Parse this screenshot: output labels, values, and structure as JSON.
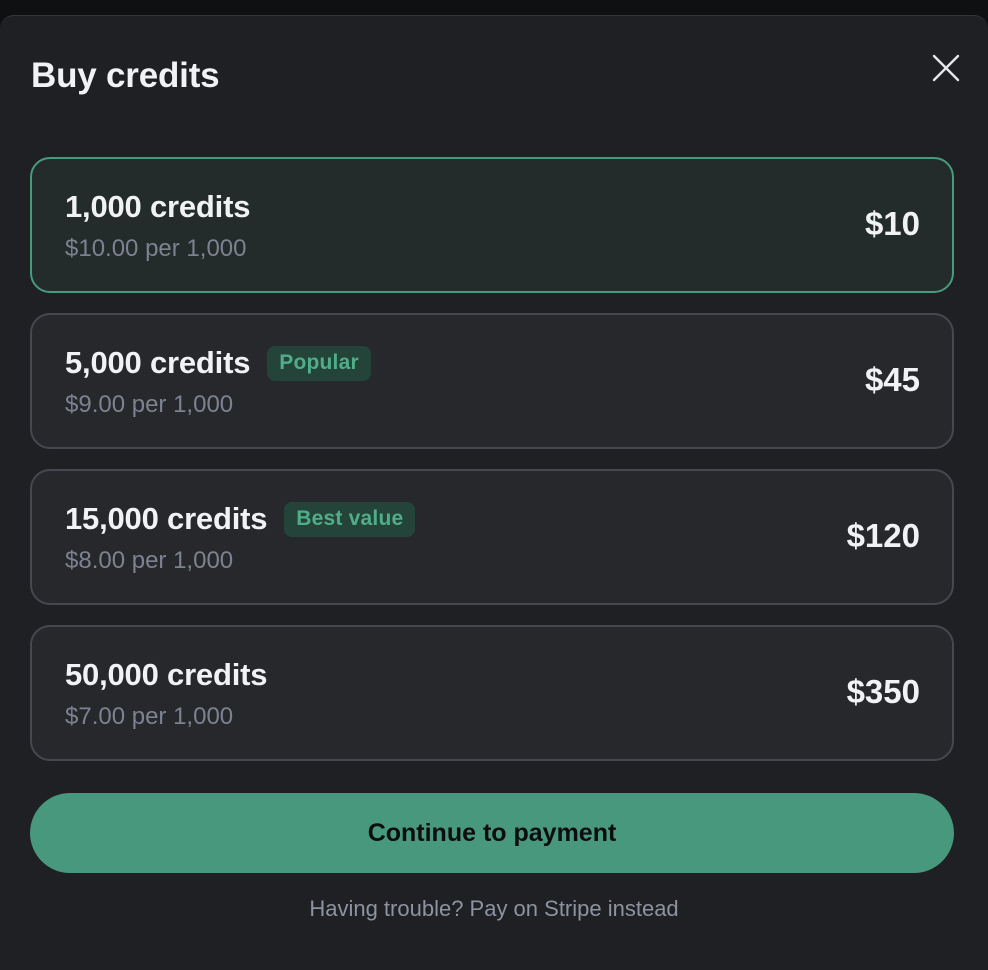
{
  "dialog": {
    "title": "Buy credits"
  },
  "options": [
    {
      "name": "1,000 credits",
      "per": "$10.00 per 1,000",
      "price": "$10",
      "badge": "",
      "selected": true
    },
    {
      "name": "5,000 credits",
      "per": "$9.00 per 1,000",
      "price": "$45",
      "badge": "Popular",
      "selected": false
    },
    {
      "name": "15,000 credits",
      "per": "$8.00 per 1,000",
      "price": "$120",
      "badge": "Best value",
      "selected": false
    },
    {
      "name": "50,000 credits",
      "per": "$7.00 per 1,000",
      "price": "$350",
      "badge": "",
      "selected": false
    }
  ],
  "actions": {
    "continue_label": "Continue to payment",
    "stripe_link": "Having trouble? Pay on Stripe instead"
  },
  "icons": {
    "close": "close-icon"
  },
  "colors": {
    "accent": "#47987c",
    "selected_border": "#479b7d",
    "badge_bg": "#24443a",
    "badge_text": "#4fae89",
    "background": "#1f2023"
  }
}
